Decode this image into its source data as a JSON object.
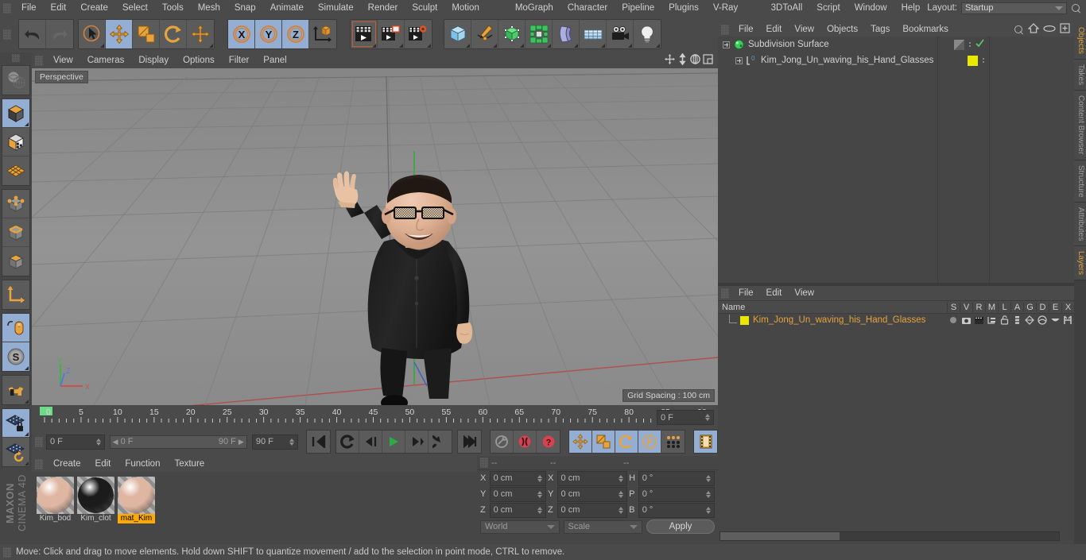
{
  "app": {
    "brand": "MAXON",
    "product": "CINEMA 4D"
  },
  "menubar": {
    "items": [
      "File",
      "Edit",
      "Create",
      "Select",
      "Tools",
      "Mesh",
      "Snap",
      "Animate",
      "Simulate",
      "Render",
      "Sculpt",
      "Motion Tracker",
      "MoGraph",
      "Character",
      "Pipeline",
      "Plugins",
      "V-Ray Bridge",
      "3DToAll",
      "Script",
      "Window",
      "Help"
    ],
    "layout_label": "Layout:",
    "layout_value": "Startup",
    "search_icon": "search-icon"
  },
  "toolbar": {
    "groups": [
      {
        "name": "undo-redo",
        "buttons": [
          {
            "icon": "undo-icon",
            "label": "Undo",
            "state": "normal"
          },
          {
            "icon": "redo-icon",
            "label": "Redo",
            "state": "disabled"
          }
        ]
      },
      {
        "name": "transform-tools",
        "buttons": [
          {
            "icon": "select-live-icon",
            "label": "Live Selection",
            "state": "normal"
          },
          {
            "icon": "move-icon",
            "label": "Move",
            "state": "selected"
          },
          {
            "icon": "scale-icon",
            "label": "Scale",
            "state": "normal"
          },
          {
            "icon": "rotate-icon",
            "label": "Rotate",
            "state": "normal"
          },
          {
            "icon": "move-axis-icon",
            "label": "Move Axis",
            "state": "normal"
          }
        ]
      },
      {
        "name": "axis-locks",
        "buttons": [
          {
            "icon": "x-axis-icon",
            "label": "X",
            "state": "selected"
          },
          {
            "icon": "y-axis-icon",
            "label": "Y",
            "state": "selected"
          },
          {
            "icon": "z-axis-icon",
            "label": "Z",
            "state": "selected"
          },
          {
            "icon": "world-coord-icon",
            "label": "World/Object",
            "state": "normal"
          }
        ]
      },
      {
        "name": "render-tools",
        "buttons": [
          {
            "icon": "render-view-icon",
            "label": "Render View",
            "state": "normal"
          },
          {
            "icon": "render-picture-icon",
            "label": "Render to Picture Viewer",
            "state": "normal"
          },
          {
            "icon": "render-settings-icon",
            "label": "Edit Render Settings",
            "state": "normal"
          }
        ]
      },
      {
        "name": "object-creation",
        "buttons": [
          {
            "icon": "cube-primitive-icon",
            "label": "Add Cube Object",
            "state": "normal"
          },
          {
            "icon": "spline-pen-icon",
            "label": "Add Spline",
            "state": "normal"
          },
          {
            "icon": "generator-nurbs-icon",
            "label": "Add Subdivision Surface",
            "state": "normal"
          },
          {
            "icon": "mograph-cloner-icon",
            "label": "Add Cloner",
            "state": "normal"
          },
          {
            "icon": "deformer-bend-icon",
            "label": "Add Bend Deformer",
            "state": "normal"
          },
          {
            "icon": "scene-floor-icon",
            "label": "Add Floor Object",
            "state": "normal"
          },
          {
            "icon": "camera-icon",
            "label": "Add Camera",
            "state": "normal"
          },
          {
            "icon": "light-icon",
            "label": "Add Light",
            "state": "normal"
          }
        ]
      }
    ]
  },
  "left_toolbar": {
    "buttons": [
      {
        "icon": "make-editable-icon",
        "label": "Make Editable",
        "state": "normal"
      },
      {
        "icon": "model-mode-icon",
        "label": "Model Mode",
        "state": "selected"
      },
      {
        "icon": "texture-mode-icon",
        "label": "Texture Mode",
        "state": "normal"
      },
      {
        "icon": "uv-mesh-icon",
        "label": "Points/UV Mesh",
        "state": "normal"
      },
      {
        "icon": "points-mode-icon",
        "label": "Points Mode",
        "state": "normal"
      },
      {
        "icon": "edges-mode-icon",
        "label": "Edges Mode",
        "state": "normal"
      },
      {
        "icon": "polygons-mode-icon",
        "label": "Polygons Mode",
        "state": "normal"
      },
      {
        "icon": "enable-axis-icon",
        "label": "Enable Axis Modification",
        "state": "normal"
      },
      {
        "icon": "viewport-solo-icon",
        "label": "Viewport Solo Single",
        "state": "selected"
      },
      {
        "icon": "viewport-solo-hierarchy-icon",
        "label": "Viewport Solo Hierarchy",
        "state": "selected"
      },
      {
        "icon": "magnet-icon",
        "label": "Enable Snapping",
        "state": "normal"
      },
      {
        "icon": "workplane-lock-icon",
        "label": "Lock Workplane",
        "state": "selected"
      },
      {
        "icon": "workplane-rotate-icon",
        "label": "Planar Workplane",
        "state": "normal"
      }
    ]
  },
  "viewport": {
    "menu": [
      "View",
      "Cameras",
      "Display",
      "Options",
      "Filter",
      "Panel"
    ],
    "view_label": "Perspective",
    "grid_spacing": "Grid Spacing : 100 cm",
    "axis_labels": {
      "x": "X",
      "y": "Y",
      "z": "Z"
    },
    "corner_icons": [
      "pan-icon",
      "dolly-icon",
      "orbit-icon",
      "maximize-icon"
    ],
    "scene_object": "Kim_Jong_Un_waving_his_Hand_Glasses"
  },
  "timeline": {
    "ticks": [
      0,
      5,
      10,
      15,
      20,
      25,
      30,
      35,
      40,
      45,
      50,
      55,
      60,
      65,
      70,
      75,
      80,
      85,
      90
    ],
    "current_frame": "0 F",
    "current_frame_right": "0 F",
    "range_start": "0 F",
    "range_end": "90 F",
    "max_frame": "90 F",
    "transport": [
      {
        "icon": "go-to-start-icon",
        "label": "Go to Start"
      },
      {
        "icon": "loop-icon",
        "label": "Play Mode / Loop"
      },
      {
        "icon": "step-back-icon",
        "label": "Go to Previous Frame"
      },
      {
        "icon": "play-icon",
        "label": "Play Forwards"
      },
      {
        "icon": "step-forward-icon",
        "label": "Go to Next Frame"
      },
      {
        "icon": "next-key-icon",
        "label": "Go to Next Key"
      },
      {
        "icon": "go-to-end-icon",
        "label": "Go to End"
      }
    ],
    "record_tools": [
      {
        "icon": "autokey-icon",
        "label": "Autokeying",
        "state": "off"
      },
      {
        "icon": "record-icon",
        "label": "Record Active Objects",
        "state": "on"
      },
      {
        "icon": "keyframe-selection-icon",
        "label": "Keyframe Selection",
        "state": "on"
      }
    ],
    "param_tools": [
      {
        "icon": "record-position-icon",
        "label": "Position",
        "state": "selected"
      },
      {
        "icon": "record-scale-icon",
        "label": "Scale",
        "state": "selected"
      },
      {
        "icon": "record-rotation-icon",
        "label": "Rotation",
        "state": "selected"
      },
      {
        "icon": "record-pla-icon",
        "label": "Parameter / PLA",
        "state": "selected"
      },
      {
        "icon": "record-points-icon",
        "label": "Point Level Animation",
        "state": "normal"
      },
      {
        "icon": "timeline-film-icon",
        "label": "Timeline",
        "state": "selected"
      }
    ]
  },
  "material_manager": {
    "menu": [
      "Create",
      "Edit",
      "Function",
      "Texture"
    ],
    "materials": [
      {
        "name": "Kim_bod",
        "display": "Kim_bod",
        "color": "#dfb6a2",
        "selected": false
      },
      {
        "name": "Kim_clot",
        "display": "Kim_clot",
        "color": "#1b1b1b",
        "selected": false
      },
      {
        "name": "mat_Kim",
        "display": "mat_Kim",
        "color": "#dfb6a2",
        "selected": true
      }
    ]
  },
  "coordinate_manager": {
    "headers": [
      "--",
      "--",
      "--"
    ],
    "rows": [
      {
        "label1": "X",
        "value1": "0 cm",
        "label2": "X",
        "value2": "0 cm",
        "label3": "H",
        "value3": "0 °"
      },
      {
        "label1": "Y",
        "value1": "0 cm",
        "label2": "Y",
        "value2": "0 cm",
        "label3": "P",
        "value3": "0 °"
      },
      {
        "label1": "Z",
        "value1": "0 cm",
        "label2": "Z",
        "value2": "0 cm",
        "label3": "B",
        "value3": "0 °"
      }
    ],
    "system_dropdown": "World",
    "mode_dropdown": "Scale",
    "apply_label": "Apply"
  },
  "object_manager": {
    "menu": [
      "File",
      "Edit",
      "View",
      "Objects",
      "Tags",
      "Bookmarks"
    ],
    "header_icons": [
      "search-icon",
      "home-icon",
      "eye-icon",
      "add-panel-icon"
    ],
    "items": [
      {
        "name": "Subdivision Surface",
        "indent": 0,
        "icon": "subdivision-surface-icon",
        "has_tag": false,
        "visible_check": true
      },
      {
        "name": "Kim_Jong_Un_waving_his_Hand_Glasses",
        "indent": 1,
        "icon": "polygon-object-icon",
        "has_tag": true,
        "tag_color": "#e8e800"
      }
    ]
  },
  "layer_manager": {
    "menu": [
      "File",
      "Edit",
      "View"
    ],
    "columns": [
      "Name",
      "S",
      "V",
      "R",
      "M",
      "L",
      "A",
      "G",
      "D",
      "E",
      "X"
    ],
    "rows": [
      {
        "name": "Kim_Jong_Un_waving_his_Hand_Glasses",
        "color": "#e8e800",
        "text_color": "#e6a23c"
      }
    ]
  },
  "right_tabs": [
    {
      "label": "Objects",
      "active": true
    },
    {
      "label": "Takes",
      "active": false
    },
    {
      "label": "Content Browser",
      "active": false
    },
    {
      "label": "Structure",
      "active": false
    },
    {
      "label": "Attributes",
      "active": false
    },
    {
      "label": "Layers",
      "active": true
    }
  ],
  "status_bar": {
    "message": "Move: Click and drag to move elements. Hold down SHIFT to quantize movement / add to the selection in point mode, CTRL to remove."
  },
  "colors": {
    "panel_bg": "#464646",
    "bar_bg": "#4a4a4a",
    "selected_blue": "#93aed2",
    "accent_orange": "#e6a23c",
    "highlight_yellow": "#ffaa00",
    "viewport_bg": "#8f8f8f"
  }
}
